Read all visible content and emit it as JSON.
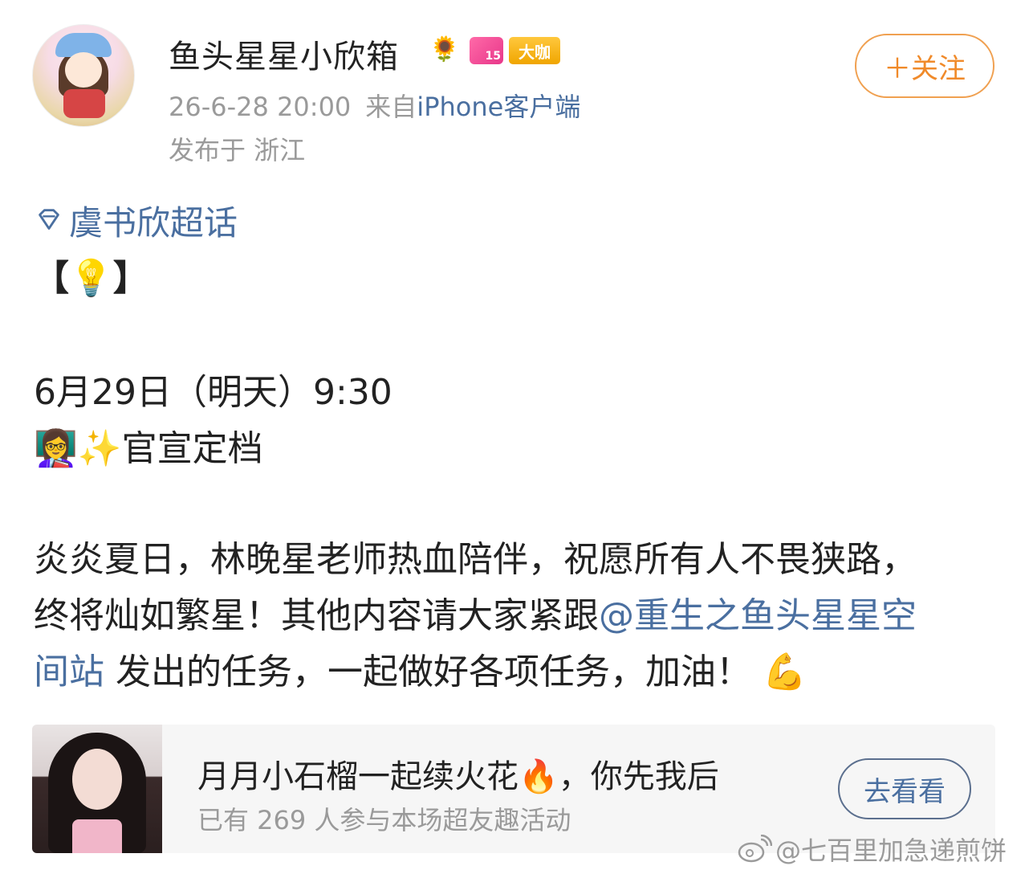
{
  "post": {
    "username": "鱼头星星小欣箱",
    "badge_emoji": "🌻",
    "level_badge": "15",
    "tag_badge": "大咖",
    "timestamp": "26-6-28 20:00",
    "source_prefix": "来自",
    "source_client": "iPhone客户端",
    "location": "发布于 浙江",
    "follow_label": "＋关注",
    "topic": "虞书欣超话",
    "bulb_line": "【💡】",
    "date_line": "6月29日（明天）9:30",
    "announce_emoji": "👩‍🏫✨",
    "announce_text": "官宣定档",
    "body_line1": "炎炎夏日，林晚星老师热血陪伴，祝愿所有人不畏狭路，",
    "body_line2_prefix": "终将灿如繁星！其他内容请大家紧跟",
    "mention_part1": "@重生之鱼头星星空",
    "mention_part2": "间站",
    "body_line3_suffix": " 发出的任务，一起做好各项任务，加油！ 💪"
  },
  "activity_card": {
    "title": "月月小石榴一起续火花🔥，你先我后",
    "subtitle": "已有 269 人参与本场超友趣活动",
    "button_label": "去看看"
  },
  "watermark": {
    "text": "@七百里加急递煎饼"
  },
  "colors": {
    "link": "#4a6fa0",
    "follow": "#f08a2a",
    "meta": "#9a9a9a"
  }
}
